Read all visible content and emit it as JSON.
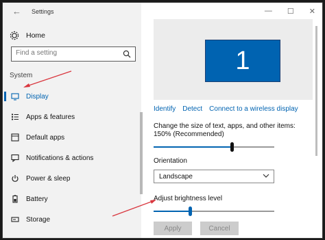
{
  "window": {
    "title": "Settings",
    "back_icon": "back-arrow-icon"
  },
  "sidebar": {
    "home_label": "Home",
    "search": {
      "placeholder": "Find a setting"
    },
    "section_label": "System",
    "items": [
      {
        "label": "Display",
        "icon": "monitor-icon",
        "active": true
      },
      {
        "label": "Apps & features",
        "icon": "list-icon"
      },
      {
        "label": "Default apps",
        "icon": "default-apps-icon"
      },
      {
        "label": "Notifications & actions",
        "icon": "notifications-icon"
      },
      {
        "label": "Power & sleep",
        "icon": "power-icon"
      },
      {
        "label": "Battery",
        "icon": "battery-icon"
      },
      {
        "label": "Storage",
        "icon": "storage-icon"
      }
    ]
  },
  "display": {
    "monitor_number": "1",
    "links": {
      "identify": "Identify",
      "detect": "Detect",
      "connect": "Connect to a wireless display"
    },
    "scale_label": "Change the size of text, apps, and other items: 150% (Recommended)",
    "scale_level": 0.65,
    "orientation_label": "Orientation",
    "orientation_value": "Landscape",
    "brightness_label": "Adjust brightness level",
    "brightness_level": 0.3,
    "apply_label": "Apply",
    "cancel_label": "Cancel"
  },
  "colors": {
    "accent": "#0063b1",
    "annotation": "#d9363e"
  }
}
